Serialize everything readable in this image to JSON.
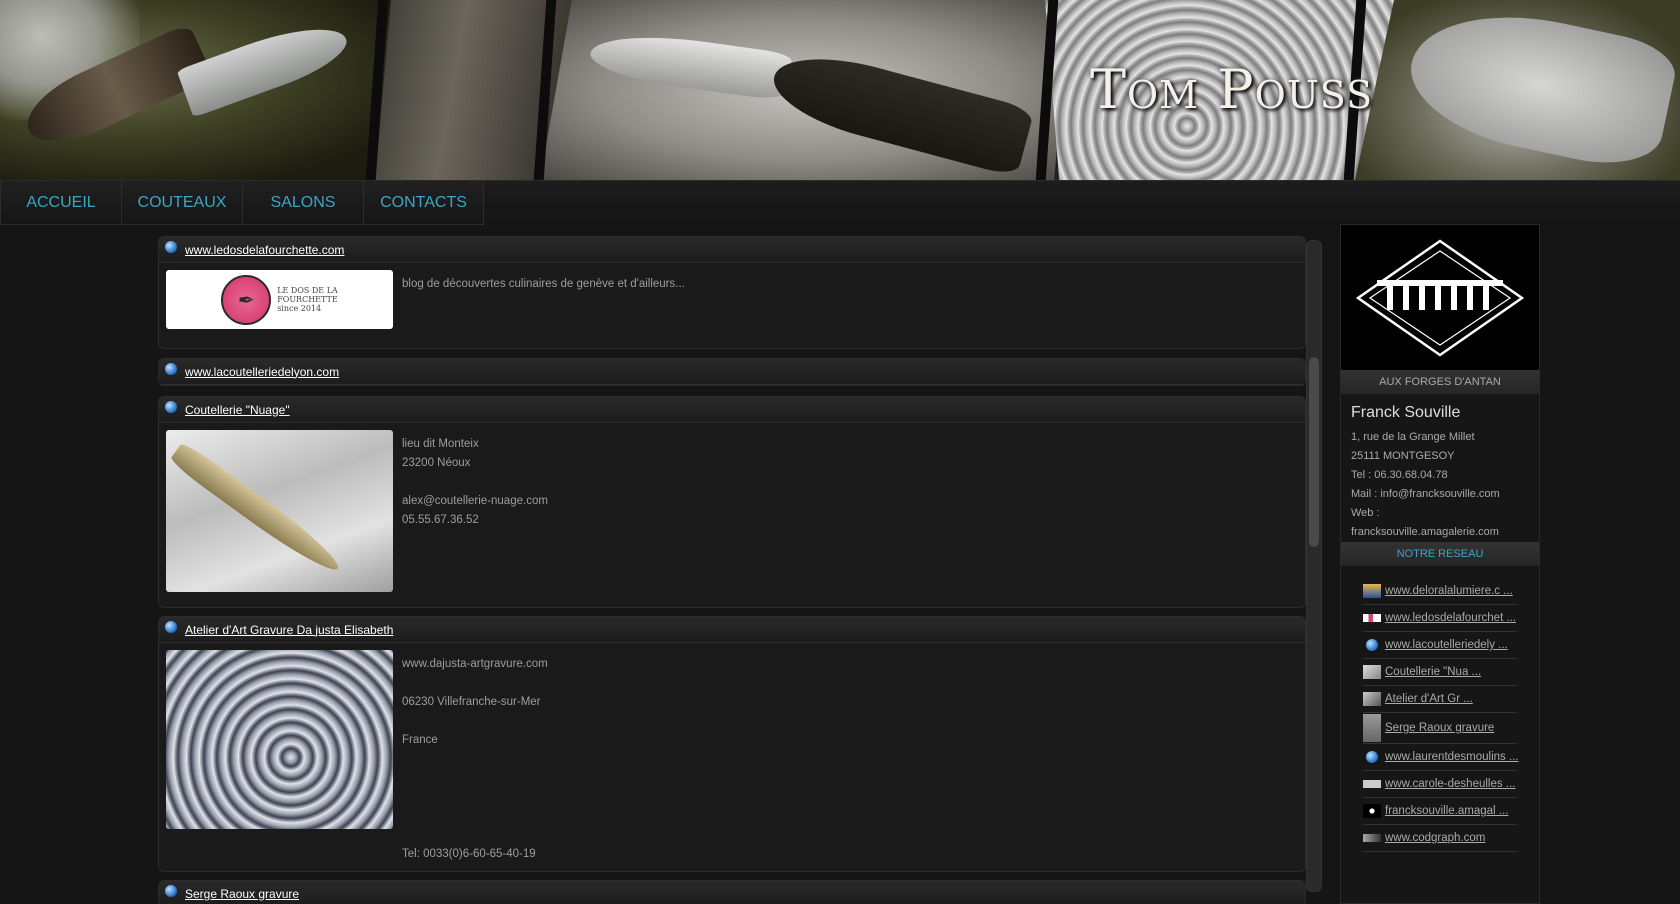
{
  "site": {
    "title": "Tom Pouss"
  },
  "nav": {
    "items": [
      "ACCUEIL",
      "COUTEAUX",
      "SALONS",
      "CONTACTS"
    ]
  },
  "links": [
    {
      "title": "www.ledosdelafourchette.com",
      "text": "blog de découvertes culinaires de genève et d'ailleurs...",
      "thumb": {
        "line1": "LE DOS DE LA",
        "line2": "FOURCHETTE",
        "line3": "since 2014"
      }
    },
    {
      "title": "www.lacoutelleriedelyon.com",
      "text": ""
    },
    {
      "title": "Coutellerie \"Nuage\"",
      "text": "lieu dit Monteix\n23200 Néoux\n\nalex@coutellerie-nuage.com\n05.55.67.36.52"
    },
    {
      "title": "Atelier d'Art Gravure Da justa Elisabeth",
      "text": "www.dajusta-artgravure.com\n\n06230 Villefranche-sur-Mer\n\nFrance\n\n\n\n\n\nTel: 0033(0)6-60-65-40-19"
    },
    {
      "title": "Serge Raoux gravure"
    }
  ],
  "sidebar": {
    "logo_caption": "AUX FORGES D'ANTAN",
    "contact": {
      "name": "Franck Souville",
      "address": "1, rue de la Grange Millet",
      "city": "25111 MONTGESOY",
      "tel": "Tel : 06.30.68.04.78",
      "mail": "Mail : info@francksouville.com",
      "web_label": "Web :",
      "web": "francksouville.amagalerie.com"
    },
    "network_title": "NOTRE RESEAU",
    "network": [
      {
        "label": "www.deloralalumiere.c ...",
        "icon": "portrait-thumb-icon"
      },
      {
        "label": "www.ledosdelafourchet ...",
        "icon": "fourchette-thumb-icon"
      },
      {
        "label": "www.lacoutelleriedely ...",
        "icon": "globe-icon"
      },
      {
        "label": "Coutellerie \"Nua ...",
        "icon": "knife-thumb-icon"
      },
      {
        "label": "Atelier d'Art Gr ...",
        "icon": "engraving-thumb-icon"
      },
      {
        "label": "Serge Raoux gravure",
        "icon": "engraving-thumb-icon"
      },
      {
        "label": "www.laurentdesmoulins ...",
        "icon": "globe-icon"
      },
      {
        "label": "www.carole-desheulles ...",
        "icon": "site-thumb-icon"
      },
      {
        "label": "francksouville.amagal ...",
        "icon": "logo-thumb-icon"
      },
      {
        "label": "www.codgraph.com",
        "icon": "codgraph-thumb-icon"
      }
    ]
  }
}
